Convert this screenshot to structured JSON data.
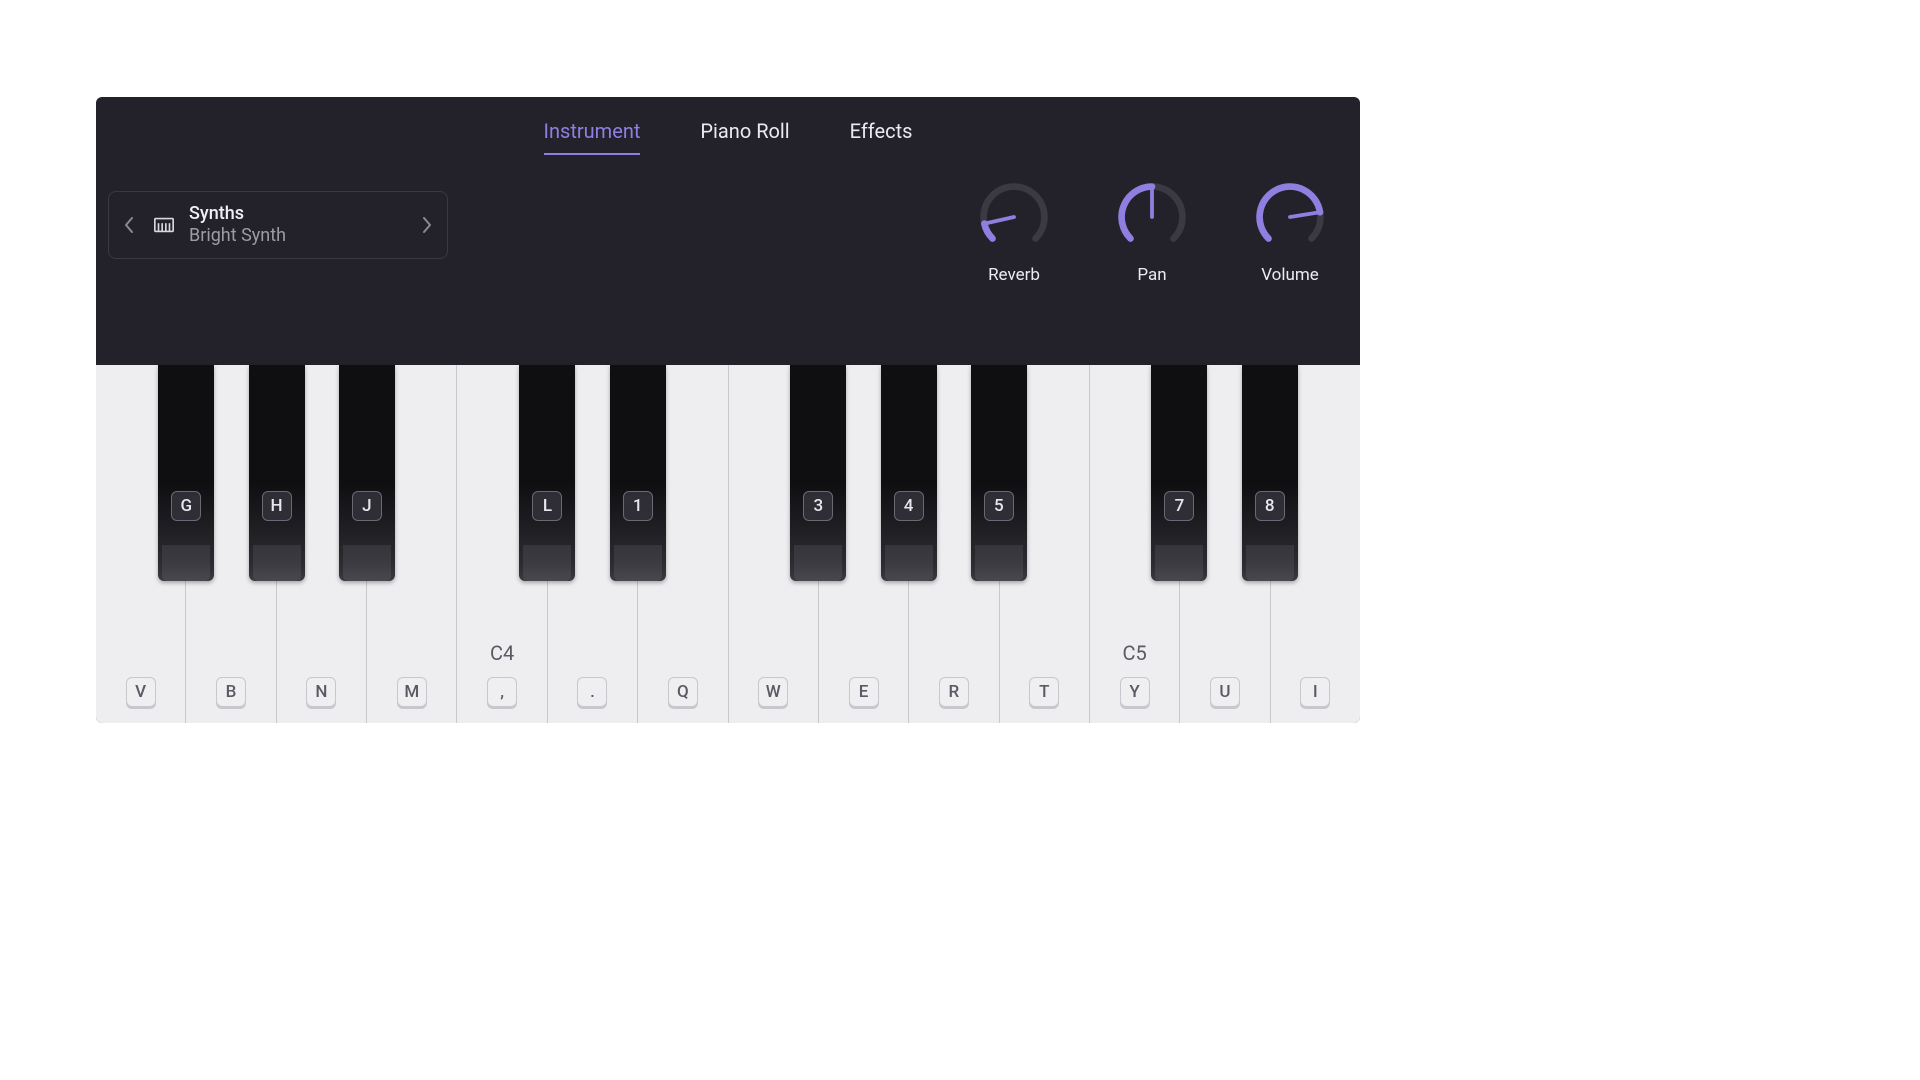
{
  "tabs": [
    {
      "label": "Instrument",
      "active": true
    },
    {
      "label": "Piano Roll",
      "active": false
    },
    {
      "label": "Effects",
      "active": false
    }
  ],
  "instrument": {
    "category": "Synths",
    "name": "Bright Synth"
  },
  "knobs": [
    {
      "label": "Reverb",
      "value": 0.12
    },
    {
      "label": "Pan",
      "value": 0.5
    },
    {
      "label": "Volume",
      "value": 0.8
    }
  ],
  "colors": {
    "accent": "#907ee0",
    "knob_track": "#3b3a42"
  },
  "keyboard": {
    "white": [
      {
        "key": "V",
        "note": ""
      },
      {
        "key": "B",
        "note": ""
      },
      {
        "key": "N",
        "note": ""
      },
      {
        "key": "M",
        "note": ""
      },
      {
        "key": ",",
        "note": "C4"
      },
      {
        "key": ".",
        "note": ""
      },
      {
        "key": "Q",
        "note": ""
      },
      {
        "key": "W",
        "note": ""
      },
      {
        "key": "E",
        "note": ""
      },
      {
        "key": "R",
        "note": ""
      },
      {
        "key": "T",
        "note": ""
      },
      {
        "key": "Y",
        "note": "C5"
      },
      {
        "key": "U",
        "note": ""
      },
      {
        "key": "I",
        "note": ""
      }
    ],
    "black": [
      {
        "key": "G",
        "between": [
          0,
          1
        ]
      },
      {
        "key": "H",
        "between": [
          1,
          2
        ]
      },
      {
        "key": "J",
        "between": [
          2,
          3
        ]
      },
      {
        "key": "L",
        "between": [
          4,
          5
        ]
      },
      {
        "key": "1",
        "between": [
          5,
          6
        ]
      },
      {
        "key": "3",
        "between": [
          7,
          8
        ]
      },
      {
        "key": "4",
        "between": [
          8,
          9
        ]
      },
      {
        "key": "5",
        "between": [
          9,
          10
        ]
      },
      {
        "key": "7",
        "between": [
          11,
          12
        ]
      },
      {
        "key": "8",
        "between": [
          12,
          13
        ]
      }
    ]
  }
}
